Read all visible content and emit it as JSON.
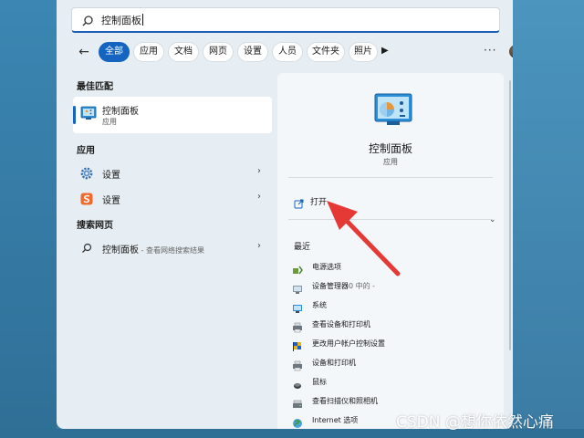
{
  "search": {
    "value": "控制面板"
  },
  "filters": {
    "back": "←",
    "chips": [
      {
        "label": "全部",
        "active": true
      },
      {
        "label": "应用",
        "active": false
      },
      {
        "label": "文档",
        "active": false
      },
      {
        "label": "网页",
        "active": false
      },
      {
        "label": "设置",
        "active": false
      },
      {
        "label": "人员",
        "active": false
      },
      {
        "label": "文件夹",
        "active": false
      },
      {
        "label": "照片",
        "active": false
      }
    ],
    "play": "▶",
    "more": "···"
  },
  "left": {
    "best_match_header": "最佳匹配",
    "best_match": {
      "title": "控制面板",
      "subtitle": "应用"
    },
    "apps_header": "应用",
    "apps": [
      {
        "label": "设置",
        "icon": "gear-icon"
      },
      {
        "label": "设置",
        "icon": "sogou-icon"
      }
    ],
    "web_header": "搜索网页",
    "web": {
      "label": "控制面板",
      "sub": " - 查看网络搜索结果"
    }
  },
  "detail": {
    "title": "控制面板",
    "subtitle": "应用",
    "open_label": "打开",
    "recent_header": "最近",
    "recent": [
      {
        "label": "电源选项",
        "icon": "power-options-icon"
      },
      {
        "label": "设备管理器",
        "sub": "0 中的 -",
        "icon": "device-manager-icon"
      },
      {
        "label": "系统",
        "icon": "system-icon"
      },
      {
        "label": "查看设备和打印机",
        "icon": "printer-icon"
      },
      {
        "label": "更改用户帐户控制设置",
        "icon": "uac-flag-icon"
      },
      {
        "label": "设备和打印机",
        "icon": "printer-icon"
      },
      {
        "label": "鼠标",
        "icon": "mouse-icon"
      },
      {
        "label": "查看扫描仪和照相机",
        "icon": "scanner-icon"
      },
      {
        "label": "Internet 选项",
        "icon": "globe-icon"
      }
    ]
  },
  "watermark": "CSDN @想你依然心痛",
  "colors": {
    "accent": "#1565c0",
    "arrow": "#e53935"
  }
}
